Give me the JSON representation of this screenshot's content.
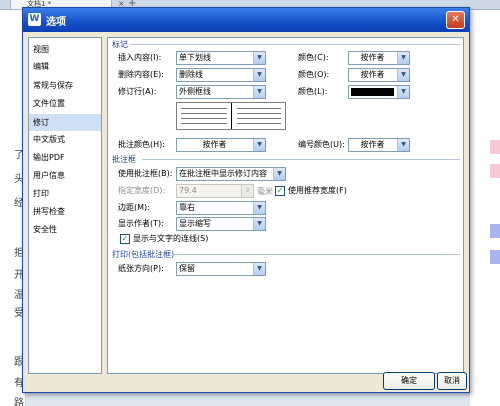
{
  "background": {
    "tab_label": "文档1 *",
    "tab_close": "×",
    "tab_add": "+",
    "left_chars": [
      "了",
      "头",
      "经",
      "拒",
      "开",
      "温",
      "受",
      "跟",
      "有",
      "路"
    ],
    "marks": {
      "pink": "#f5c9d5",
      "blue": "#aab4ef"
    }
  },
  "dialog": {
    "title": "选项",
    "title_icon": "W",
    "close_glyph": "✕"
  },
  "sidebar": {
    "items": [
      {
        "label": "视图"
      },
      {
        "label": "编辑"
      },
      {
        "label": "常规与保存"
      },
      {
        "label": "文件位置"
      },
      {
        "label": "修订"
      },
      {
        "label": "中文版式"
      },
      {
        "label": "输出PDF"
      },
      {
        "label": "用户信息"
      },
      {
        "label": "打印"
      },
      {
        "label": "拼写检查"
      },
      {
        "label": "安全性"
      }
    ],
    "active_index": 4
  },
  "marks_section": {
    "title": "标记",
    "insert_label": "插入内容(I):",
    "insert_value": "单下划线",
    "insert_color_label": "颜色(C):",
    "insert_color_value": "按作者",
    "delete_label": "删除内容(E):",
    "delete_value": "删除线",
    "delete_color_label": "颜色(O):",
    "delete_color_value": "按作者",
    "revline_label": "修订行(A):",
    "revline_value": "外侧框线",
    "revline_color_label": "颜色(L):",
    "revline_color": "#000000",
    "comment_color_label": "批注颜色(H):",
    "comment_color_value": "按作者",
    "number_color_label": "编号颜色(U):",
    "number_color_value": "按作者"
  },
  "balloon_section": {
    "title": "批注框",
    "use_label": "使用批注框(B):",
    "use_value": "在批注框中显示修订内容",
    "width_label": "指定宽度(D):",
    "width_value": "79.4",
    "width_unit": "毫米",
    "recommend_label": "使用推荐宽度(F)",
    "recommend_checked": true,
    "margin_label": "边距(M):",
    "margin_value": "靠右",
    "author_label": "显示作者(T):",
    "author_value": "显示缩写",
    "lines_label": "显示与文字的连线(S)",
    "lines_checked": true
  },
  "print_section": {
    "title": "打印(包括批注框)",
    "orientation_label": "纸张方向(P):",
    "orientation_value": "保留"
  },
  "buttons": {
    "ok": "确定",
    "cancel": "取消"
  }
}
